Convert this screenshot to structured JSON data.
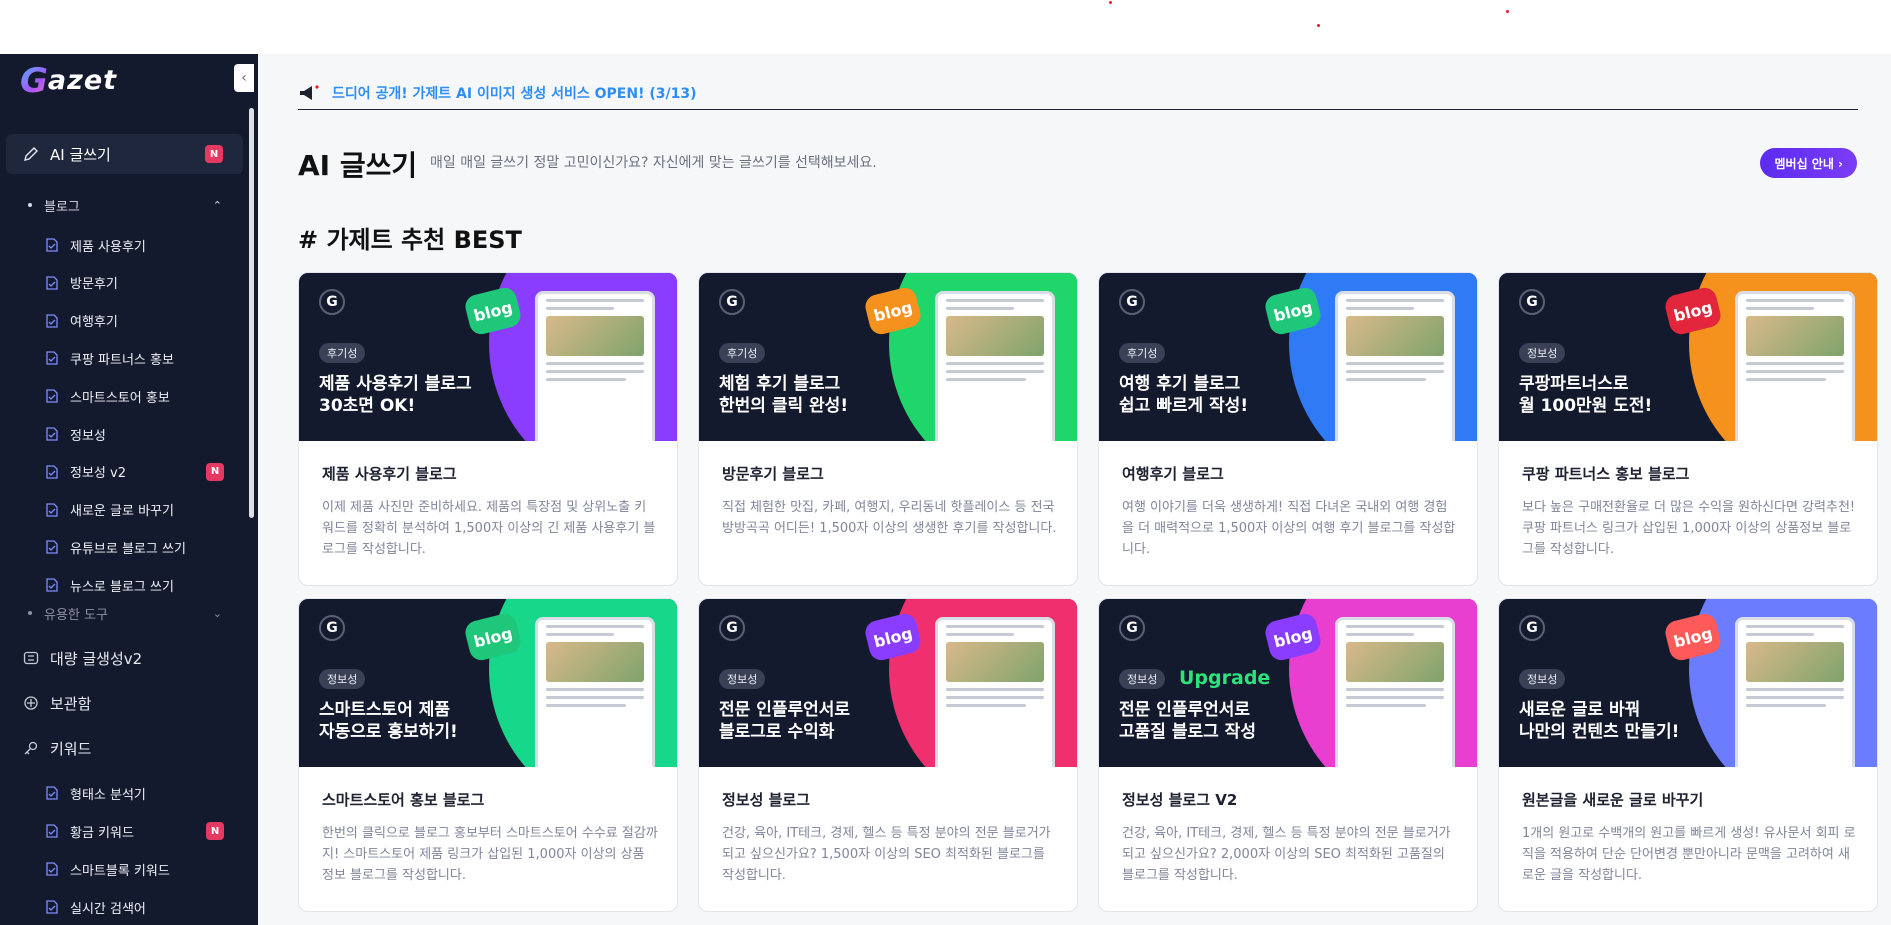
{
  "logo": {
    "letter": "G",
    "rest": "azet"
  },
  "sidebar": {
    "menus": [
      {
        "label": "AI 글쓰기",
        "badge": "N"
      },
      {
        "label": "대량 글생성v2"
      },
      {
        "label": "보관함"
      },
      {
        "label": "키워드"
      }
    ],
    "blog_group": "블로그",
    "tools_group": "유용한 도구",
    "blog_items": [
      {
        "label": "제품 사용후기"
      },
      {
        "label": "방문후기"
      },
      {
        "label": "여행후기"
      },
      {
        "label": "쿠팡 파트너스 홍보"
      },
      {
        "label": "스마트스토어 홍보"
      },
      {
        "label": "정보성"
      },
      {
        "label": "정보성 v2",
        "badge": "N"
      },
      {
        "label": "새로운 글로 바꾸기"
      },
      {
        "label": "유튜브로 블로그 쓰기"
      },
      {
        "label": "뉴스로 블로그 쓰기"
      }
    ],
    "keyword_items": [
      {
        "label": "형태소 분석기"
      },
      {
        "label": "황금 키워드",
        "badge": "N"
      },
      {
        "label": "스마트블록 키워드"
      },
      {
        "label": "실시간 검색어"
      }
    ]
  },
  "notice": "드디어 공개! 가제트 AI 이미지 생성 서비스 OPEN! (3/13)",
  "page": {
    "title": "AI 글쓰기",
    "description": "매일 매일 글쓰기 정말 고민이신가요? 자신에게 맞는 글쓰기를 선택해보세요.",
    "member_button": "멤버십 안내 ›",
    "section_title": "# 가제트 추천 BEST"
  },
  "cards": [
    {
      "tag": "후기성",
      "headline": "제품 사용후기 블로그\n30초면 OK!",
      "title": "제품 사용후기 블로그",
      "desc": "이제 제품 사진만 준비하세요. 제품의 특장점 및 상위노출 키워드를 정확히 분석하여 1,500자 이상의 긴 제품 사용후기 블로그를 작성합니다.",
      "accent": "#8b3dff"
    },
    {
      "tag": "후기성",
      "headline": "체험 후기 블로그\n한번의 클릭 완성!",
      "title": "방문후기 블로그",
      "desc": "직접 체험한 맛집, 카페, 여행지, 우리동네 핫플레이스 등 전국 방방곡곡 어디든! 1,500자 이상의 생생한 후기를 작성합니다.",
      "accent": "#1ed66a"
    },
    {
      "tag": "후기성",
      "headline": "여행 후기 블로그\n쉽고 빠르게 작성!",
      "title": "여행후기 블로그",
      "desc": "여행 이야기를 더욱 생생하게! 직접 다녀온 국내외 여행 경험을 더 매력적으로 1,500자 이상의 여행 후기 블로그를 작성합니다.",
      "accent": "#2f7bf5"
    },
    {
      "tag": "정보성",
      "headline": "쿠팡파트너스로\n월 100만원 도전!",
      "title": "쿠팡 파트너스 홍보 블로그",
      "desc": "보다 높은 구매전환율로 더 많은 수익을 원하신다면 강력추천! 쿠팡 파트너스 링크가 삽입된 1,000자 이상의 상품정보 블로그를 작성합니다.",
      "accent": "#f5921e"
    },
    {
      "tag": "정보성",
      "headline": "스마트스토어 제품\n자동으로 홍보하기!",
      "title": "스마트스토어 홍보 블로그",
      "desc": "한번의 클릭으로 블로그 홍보부터 스마트스토어 수수료 절감까지! 스마트스토어 제품 링크가 삽입된 1,000자 이상의 상품 정보 블로그를 작성합니다.",
      "accent": "#17d88a"
    },
    {
      "tag": "정보성",
      "headline": "전문 인플루언서로\n블로그로 수익화",
      "title": "정보성 블로그",
      "desc": "건강, 육아, IT테크, 경제, 헬스 등 특정 분야의 전문 블로거가 되고 싶으신가요? 1,500자 이상의 SEO 최적화된 블로그를 작성합니다.",
      "accent": "#f0306e"
    },
    {
      "tag": "정보성",
      "upgrade": "Upgrade",
      "headline": "전문 인플루언서로\n고품질 블로그 작성",
      "title": "정보성 블로그 V2",
      "desc": "건강, 육아, IT테크, 경제, 헬스 등 특정 분야의 전문 블로거가 되고 싶으신가요? 2,000자 이상의 SEO 최적화된 고품질의 블로그를 작성합니다.",
      "accent": "#e83fd0"
    },
    {
      "tag": "정보성",
      "headline": "새로운 글로 바꿔\n나만의 컨텐츠 만들기!",
      "title": "원본글을 새로운 글로 바꾸기",
      "desc": "1개의 원고로 수백개의 원고를 빠르게 생성! 유사문서 회피 로직을 적용하여 단순 단어변경 뿐만아니라 문맥을 고려하여 새로운 글을 작성합니다.",
      "accent": "#6b7cff"
    }
  ]
}
